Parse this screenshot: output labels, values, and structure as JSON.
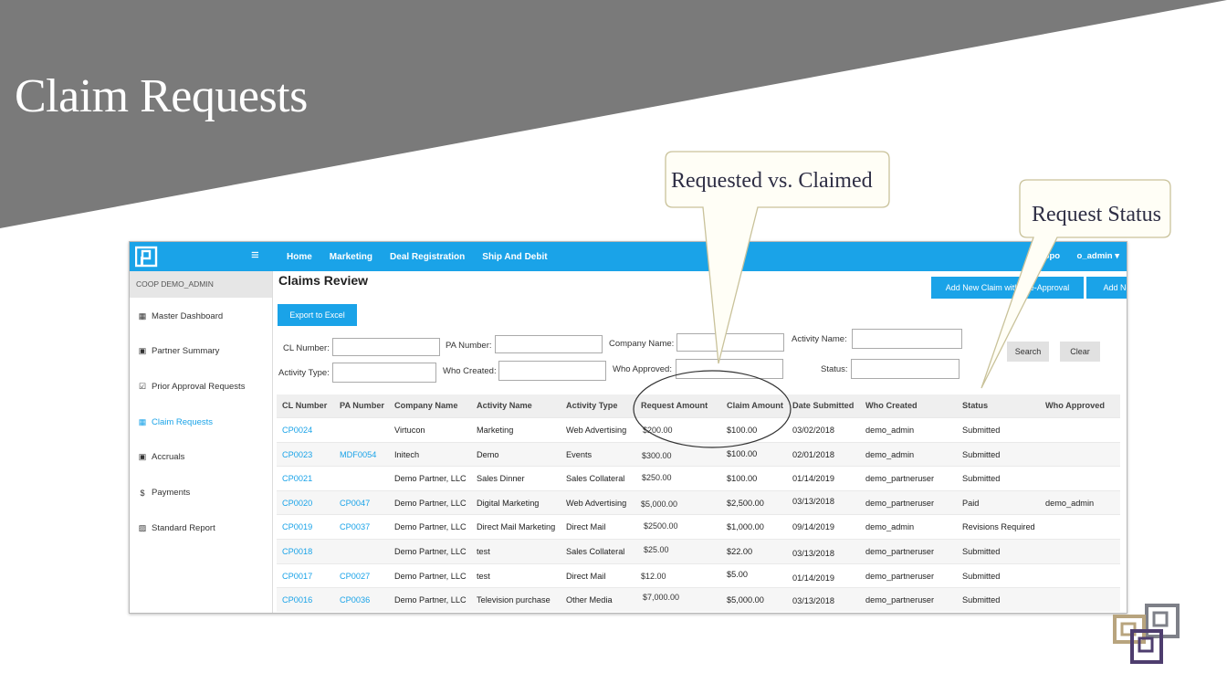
{
  "slide": {
    "title": "Claim Requests",
    "banner_color": "#7a7a7a"
  },
  "app": {
    "accent": "#1aa3e8",
    "nav": [
      "Home",
      "Marketing",
      "Deal Registration",
      "Ship And Debit"
    ],
    "user": "Suppo       o_admin ▾",
    "sidebar": {
      "header": "COOP DEMO_ADMIN",
      "items": [
        {
          "label": "Master Dashboard",
          "icon": "dashboard-icon",
          "glyph": "▦"
        },
        {
          "label": "Partner Summary",
          "icon": "folder-icon",
          "glyph": "▣"
        },
        {
          "label": "Prior Approval Requests",
          "icon": "checkbox-icon",
          "glyph": "☑"
        },
        {
          "label": "Claim Requests",
          "icon": "claims-icon",
          "glyph": "▦"
        },
        {
          "label": "Accruals",
          "icon": "money-icon",
          "glyph": "▣"
        },
        {
          "label": "Payments",
          "icon": "dollar-icon",
          "glyph": "$"
        },
        {
          "label": "Standard Report",
          "icon": "report-icon",
          "glyph": "▨"
        }
      ]
    },
    "page_title": "Claims Review",
    "buttons": {
      "export": "Export to Excel",
      "add_with": "Add New Claim with Pre-Approval",
      "add_without": "Add New Claim       ut Pre-Approval",
      "search": "Search",
      "clear": "Clear"
    },
    "filters": {
      "cl_number": "CL Number:",
      "pa_number": "PA Number:",
      "company_name": "Company Name:",
      "activity_name": "Activity Name:",
      "activity_type": "Activity Type:",
      "who_created": "Who Created:",
      "who_approved": "Who Approved:",
      "status": "Status:"
    },
    "columns": [
      "CL Number",
      "PA Number",
      "Company Name",
      "Activity Name",
      "Activity Type",
      "Request Amount",
      "Claim Amount",
      "Date Submitted",
      "Who Created",
      "Status",
      "Who Approved"
    ],
    "rows": [
      [
        "CP0024",
        "",
        "Virtucon",
        "Marketing",
        "Web Advertising",
        "$200.00",
        "$100.00",
        "03/02/2018",
        "demo_admin",
        "Submitted",
        ""
      ],
      [
        "CP0023",
        "MDF0054",
        "Initech",
        "Demo",
        "Events",
        "$300.00",
        "$100.00",
        "02/01/2018",
        "demo_admin",
        "Submitted",
        ""
      ],
      [
        "CP0021",
        "",
        "Demo Partner, LLC",
        "Sales Dinner",
        "Sales Collateral",
        "$250.00",
        "$100.00",
        "01/14/2019",
        "demo_partneruser",
        "Submitted",
        ""
      ],
      [
        "CP0020",
        "CP0047",
        "Demo Partner, LLC",
        "Digital Marketing",
        "Web Advertising",
        "$5,000.00",
        "$2,500.00",
        "03/13/2018",
        "demo_partneruser",
        "Paid",
        "demo_admin"
      ],
      [
        "CP0019",
        "CP0037",
        "Demo Partner, LLC",
        "Direct Mail Marketing",
        "Direct Mail",
        "$2500.00",
        "$1,000.00",
        "09/14/2019",
        "demo_admin",
        "Revisions Required",
        ""
      ],
      [
        "CP0018",
        "",
        "Demo Partner, LLC",
        "test",
        "Sales Collateral",
        "$25.00",
        "$22.00",
        "03/13/2018",
        "demo_partneruser",
        "Submitted",
        ""
      ],
      [
        "CP0017",
        "CP0027",
        "Demo Partner, LLC",
        "test",
        "Direct Mail",
        "$12.00",
        "$5.00",
        "01/14/2019",
        "demo_partneruser",
        "Submitted",
        ""
      ],
      [
        "CP0016",
        "CP0036",
        "Demo Partner, LLC",
        "Television purchase",
        "Other Media",
        "$7,000.00",
        "$5,000.00",
        "03/13/2018",
        "demo_partneruser",
        "Submitted",
        ""
      ]
    ]
  },
  "callouts": {
    "requested_vs_claimed": "Requested vs. Claimed",
    "request_status": "Request Status",
    "fill": "#fffef6",
    "stroke": "#c9c29a"
  }
}
